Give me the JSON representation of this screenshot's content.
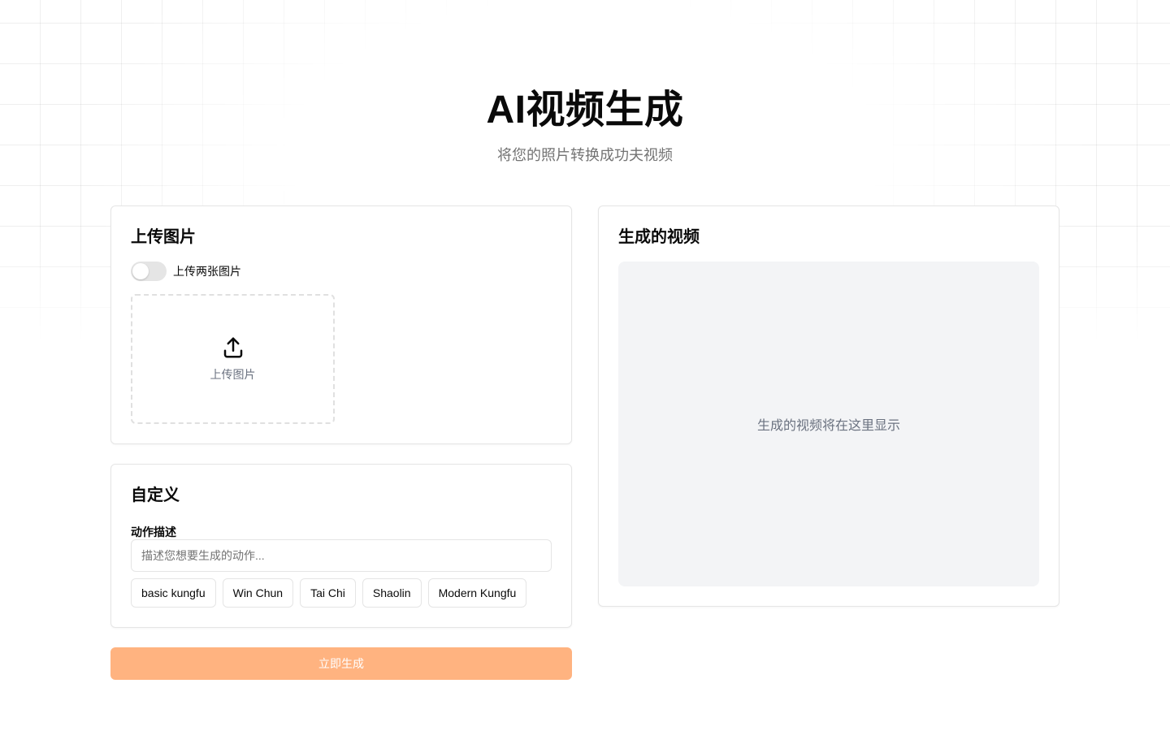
{
  "header": {
    "title": "AI视频生成",
    "subtitle": "将您的照片转换成功夫视频"
  },
  "upload": {
    "title": "上传图片",
    "toggle_label": "上传两张图片",
    "toggle_on": false,
    "dropzone_label": "上传图片",
    "icon": "upload-icon"
  },
  "custom": {
    "title": "自定义",
    "field_label": "动作描述",
    "input_value": "",
    "input_placeholder": "描述您想要生成的动作...",
    "presets": [
      {
        "label": "basic kungfu"
      },
      {
        "label": "Win Chun"
      },
      {
        "label": "Tai Chi"
      },
      {
        "label": "Shaolin"
      },
      {
        "label": "Modern Kungfu"
      }
    ]
  },
  "generate": {
    "label": "立即生成",
    "color": "#ffb380"
  },
  "video": {
    "title": "生成的视频",
    "placeholder": "生成的视频将在这里显示"
  }
}
